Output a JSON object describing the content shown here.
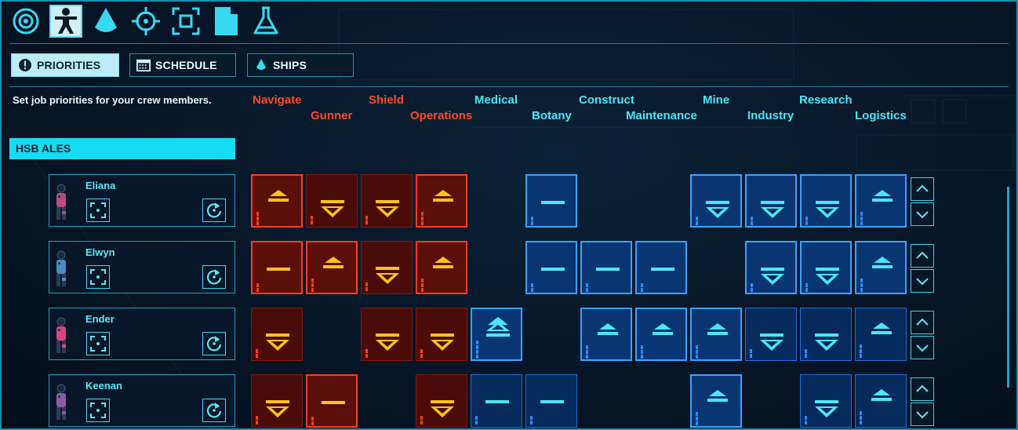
{
  "top_icons": [
    "target-icon",
    "crew-icon",
    "ship-icon",
    "crosshair-icon",
    "focus-icon",
    "document-icon",
    "flask-icon"
  ],
  "tabs": [
    {
      "label": "PRIORITIES",
      "icon": "alert-icon",
      "active": true
    },
    {
      "label": "SCHEDULE",
      "icon": "calendar-icon",
      "active": false
    },
    {
      "label": "SHIPS",
      "icon": "ship-icon",
      "active": false
    }
  ],
  "hint": "Set job priorities for your crew members.",
  "jobs": [
    {
      "label": "Navigate",
      "group": "red"
    },
    {
      "label": "Gunner",
      "group": "red"
    },
    {
      "label": "Shield",
      "group": "red"
    },
    {
      "label": "Operations",
      "group": "red"
    },
    {
      "label": "Medical",
      "group": "blue"
    },
    {
      "label": "Botany",
      "group": "blue"
    },
    {
      "label": "Construct",
      "group": "blue"
    },
    {
      "label": "Maintenance",
      "group": "blue"
    },
    {
      "label": "Mine",
      "group": "blue"
    },
    {
      "label": "Industry",
      "group": "blue"
    },
    {
      "label": "Research",
      "group": "blue"
    },
    {
      "label": "Logistics",
      "group": "blue"
    }
  ],
  "ship_name": "HSB ALES",
  "crew": [
    {
      "name": "Eliana",
      "suit": "#b84c7a",
      "priorities": [
        "up",
        "down",
        "down",
        "up",
        "none",
        "dash",
        "none",
        "none",
        "down",
        "down",
        "down",
        "up"
      ],
      "hi": [
        1,
        0,
        0,
        1,
        0,
        1,
        0,
        0,
        1,
        1,
        1,
        1
      ]
    },
    {
      "name": "Elwyn",
      "suit": "#4a8cc8",
      "priorities": [
        "dash",
        "up",
        "down",
        "up",
        "none",
        "dash",
        "dash",
        "dash",
        "none",
        "down",
        "down",
        "up"
      ],
      "hi": [
        1,
        1,
        0,
        1,
        0,
        1,
        1,
        1,
        0,
        1,
        1,
        1
      ]
    },
    {
      "name": "Ender",
      "suit": "#e0407a",
      "priorities": [
        "down",
        "none",
        "down",
        "down",
        "top",
        "none",
        "up",
        "up",
        "up",
        "down",
        "down",
        "up"
      ],
      "hi": [
        0,
        0,
        0,
        0,
        1,
        0,
        1,
        1,
        1,
        0,
        0,
        0
      ]
    },
    {
      "name": "Keenan",
      "suit": "#8a5aa8",
      "priorities": [
        "down",
        "dash",
        "none",
        "down",
        "dash",
        "dash",
        "none",
        "none",
        "up",
        "none",
        "down",
        "up"
      ],
      "hi": [
        0,
        1,
        0,
        0,
        0,
        0,
        0,
        0,
        1,
        0,
        0,
        0
      ]
    }
  ],
  "colors": {
    "accent": "#16dcf3",
    "red": "#ff4a24",
    "red_icon": "#ffc21a",
    "blue_icon": "#4ce6f7"
  }
}
